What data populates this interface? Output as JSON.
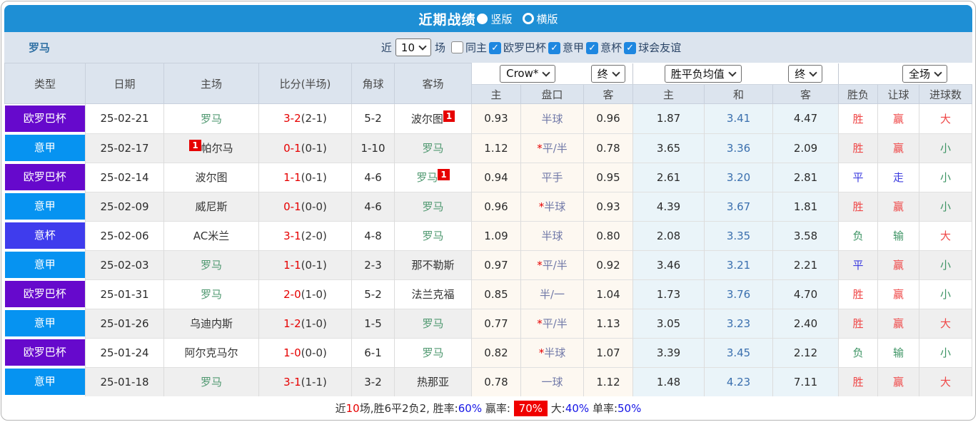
{
  "header": {
    "title": "近期战绩",
    "vertical_label": "竖版",
    "horizontal_label": "横版"
  },
  "filters": {
    "team": "罗马",
    "recent_label": "近",
    "recent_value": "10",
    "matches_label": "场",
    "same_home_label": "同主",
    "leagues": [
      {
        "label": "欧罗巴杯",
        "checked": true
      },
      {
        "label": "意甲",
        "checked": true
      },
      {
        "label": "意杯",
        "checked": true
      },
      {
        "label": "球会友谊",
        "checked": true
      }
    ]
  },
  "table": {
    "main_columns": [
      "类型",
      "日期",
      "主场",
      "比分(半场)",
      "角球",
      "客场"
    ],
    "sub_columns": [
      "主",
      "盘口",
      "客",
      "主",
      "和",
      "客",
      "胜负",
      "让球",
      "进球数"
    ],
    "selects": {
      "bookmaker": "Crow*",
      "time1": "终",
      "avg": "胜平负均值",
      "time2": "终",
      "scope": "全场"
    },
    "rows": [
      {
        "league": "欧罗巴杯",
        "league_key": "europa",
        "date": "25-02-21",
        "home": "罗马",
        "home_green": true,
        "home_card": "",
        "away": "波尔图",
        "away_green": false,
        "away_card": "after",
        "score_ft": "3-2",
        "score_ht": "(2-1)",
        "corners": "5-2",
        "odd_home": "0.93",
        "handicap": "半球",
        "handicap_star": false,
        "odd_away": "0.96",
        "avg_home": "1.87",
        "avg_draw": "3.41",
        "avg_away": "4.47",
        "wdl": "胜",
        "wdl_c": "red",
        "handi_res": "赢",
        "handi_c": "red",
        "goals": "大",
        "goals_c": "red"
      },
      {
        "league": "意甲",
        "league_key": "seriea",
        "date": "25-02-17",
        "home": "帕尔马",
        "home_green": false,
        "home_card": "before",
        "away": "罗马",
        "away_green": true,
        "away_card": "",
        "score_ft": "0-1",
        "score_ht": "(0-1)",
        "corners": "1-10",
        "odd_home": "1.12",
        "handicap": "平/半",
        "handicap_star": true,
        "odd_away": "0.78",
        "avg_home": "3.65",
        "avg_draw": "3.36",
        "avg_away": "2.09",
        "wdl": "胜",
        "wdl_c": "red",
        "handi_res": "赢",
        "handi_c": "red",
        "goals": "小",
        "goals_c": "green"
      },
      {
        "league": "欧罗巴杯",
        "league_key": "europa",
        "date": "25-02-14",
        "home": "波尔图",
        "home_green": false,
        "home_card": "",
        "away": "罗马",
        "away_green": true,
        "away_card": "after",
        "score_ft": "1-1",
        "score_ht": "(0-1)",
        "corners": "4-6",
        "odd_home": "0.94",
        "handicap": "平手",
        "handicap_star": false,
        "odd_away": "0.95",
        "avg_home": "2.61",
        "avg_draw": "3.20",
        "avg_away": "2.81",
        "wdl": "平",
        "wdl_c": "blue",
        "handi_res": "走",
        "handi_c": "blue",
        "goals": "小",
        "goals_c": "green"
      },
      {
        "league": "意甲",
        "league_key": "seriea",
        "date": "25-02-09",
        "home": "威尼斯",
        "home_green": false,
        "home_card": "",
        "away": "罗马",
        "away_green": true,
        "away_card": "",
        "score_ft": "0-1",
        "score_ht": "(0-0)",
        "corners": "4-6",
        "odd_home": "0.96",
        "handicap": "半球",
        "handicap_star": true,
        "odd_away": "0.93",
        "avg_home": "4.39",
        "avg_draw": "3.67",
        "avg_away": "1.81",
        "wdl": "胜",
        "wdl_c": "red",
        "handi_res": "赢",
        "handi_c": "red",
        "goals": "小",
        "goals_c": "green"
      },
      {
        "league": "意杯",
        "league_key": "coppa",
        "date": "25-02-06",
        "home": "AC米兰",
        "home_green": false,
        "home_card": "",
        "away": "罗马",
        "away_green": true,
        "away_card": "",
        "score_ft": "3-1",
        "score_ht": "(2-0)",
        "corners": "4-8",
        "odd_home": "1.09",
        "handicap": "半球",
        "handicap_star": false,
        "odd_away": "0.80",
        "avg_home": "2.08",
        "avg_draw": "3.35",
        "avg_away": "3.58",
        "wdl": "负",
        "wdl_c": "green",
        "handi_res": "输",
        "handi_c": "green",
        "goals": "大",
        "goals_c": "red"
      },
      {
        "league": "意甲",
        "league_key": "seriea",
        "date": "25-02-03",
        "home": "罗马",
        "home_green": true,
        "home_card": "",
        "away": "那不勒斯",
        "away_green": false,
        "away_card": "",
        "score_ft": "1-1",
        "score_ht": "(0-1)",
        "corners": "2-3",
        "odd_home": "0.97",
        "handicap": "平/半",
        "handicap_star": true,
        "odd_away": "0.92",
        "avg_home": "3.46",
        "avg_draw": "3.21",
        "avg_away": "2.21",
        "wdl": "平",
        "wdl_c": "blue",
        "handi_res": "赢",
        "handi_c": "red",
        "goals": "小",
        "goals_c": "green"
      },
      {
        "league": "欧罗巴杯",
        "league_key": "europa",
        "date": "25-01-31",
        "home": "罗马",
        "home_green": true,
        "home_card": "",
        "away": "法兰克福",
        "away_green": false,
        "away_card": "",
        "score_ft": "2-0",
        "score_ht": "(1-0)",
        "corners": "5-2",
        "odd_home": "0.85",
        "handicap": "半/一",
        "handicap_star": false,
        "odd_away": "1.04",
        "avg_home": "1.73",
        "avg_draw": "3.76",
        "avg_away": "4.70",
        "wdl": "胜",
        "wdl_c": "red",
        "handi_res": "赢",
        "handi_c": "red",
        "goals": "小",
        "goals_c": "green"
      },
      {
        "league": "意甲",
        "league_key": "seriea",
        "date": "25-01-26",
        "home": "乌迪内斯",
        "home_green": false,
        "home_card": "",
        "away": "罗马",
        "away_green": true,
        "away_card": "",
        "score_ft": "1-2",
        "score_ht": "(1-0)",
        "corners": "1-5",
        "odd_home": "0.77",
        "handicap": "平/半",
        "handicap_star": true,
        "odd_away": "1.13",
        "avg_home": "3.05",
        "avg_draw": "3.23",
        "avg_away": "2.40",
        "wdl": "胜",
        "wdl_c": "red",
        "handi_res": "赢",
        "handi_c": "red",
        "goals": "大",
        "goals_c": "red"
      },
      {
        "league": "欧罗巴杯",
        "league_key": "europa",
        "date": "25-01-24",
        "home": "阿尔克马尔",
        "home_green": false,
        "home_card": "",
        "away": "罗马",
        "away_green": true,
        "away_card": "",
        "score_ft": "1-0",
        "score_ht": "(0-0)",
        "corners": "6-1",
        "odd_home": "0.82",
        "handicap": "半球",
        "handicap_star": true,
        "odd_away": "1.07",
        "avg_home": "3.39",
        "avg_draw": "3.45",
        "avg_away": "2.12",
        "wdl": "负",
        "wdl_c": "green",
        "handi_res": "输",
        "handi_c": "green",
        "goals": "小",
        "goals_c": "green"
      },
      {
        "league": "意甲",
        "league_key": "seriea",
        "date": "25-01-18",
        "home": "罗马",
        "home_green": true,
        "home_card": "",
        "away": "热那亚",
        "away_green": false,
        "away_card": "",
        "score_ft": "3-1",
        "score_ht": "(1-1)",
        "corners": "3-2",
        "odd_home": "0.78",
        "handicap": "一球",
        "handicap_star": false,
        "odd_away": "1.12",
        "avg_home": "1.48",
        "avg_draw": "4.23",
        "avg_away": "7.11",
        "wdl": "胜",
        "wdl_c": "red",
        "handi_res": "赢",
        "handi_c": "red",
        "goals": "大",
        "goals_c": "red"
      }
    ]
  },
  "summary": {
    "segments": [
      {
        "text": "近",
        "style": "dark"
      },
      {
        "text": "10",
        "style": "red"
      },
      {
        "text": "场,胜6平2负2, 胜率:",
        "style": "dark"
      },
      {
        "text": "60%",
        "style": "blue"
      },
      {
        "text": " 赢率: ",
        "style": "dark"
      },
      {
        "text": "70%",
        "style": "hl"
      },
      {
        "text": " 大:",
        "style": "dark"
      },
      {
        "text": "40%",
        "style": "blue"
      },
      {
        "text": " 单率:",
        "style": "dark"
      },
      {
        "text": "50%",
        "style": "blue"
      }
    ]
  },
  "colors": {
    "title_bar": "#1e8fd5",
    "header_bg": "#dce4ee",
    "league": {
      "europa": "#6609cc",
      "seriea": "#0693f1",
      "coppa": "#3f3ced"
    },
    "team_green": "#4f9870",
    "score_red": "#e60000",
    "result_red": "#ef4747",
    "result_blue": "#3c3cdf",
    "result_green": "#3d9464",
    "avg_draw_blue": "#3a6fae",
    "summary_blue": "#1414e6",
    "highlight_red": "#f00000"
  }
}
